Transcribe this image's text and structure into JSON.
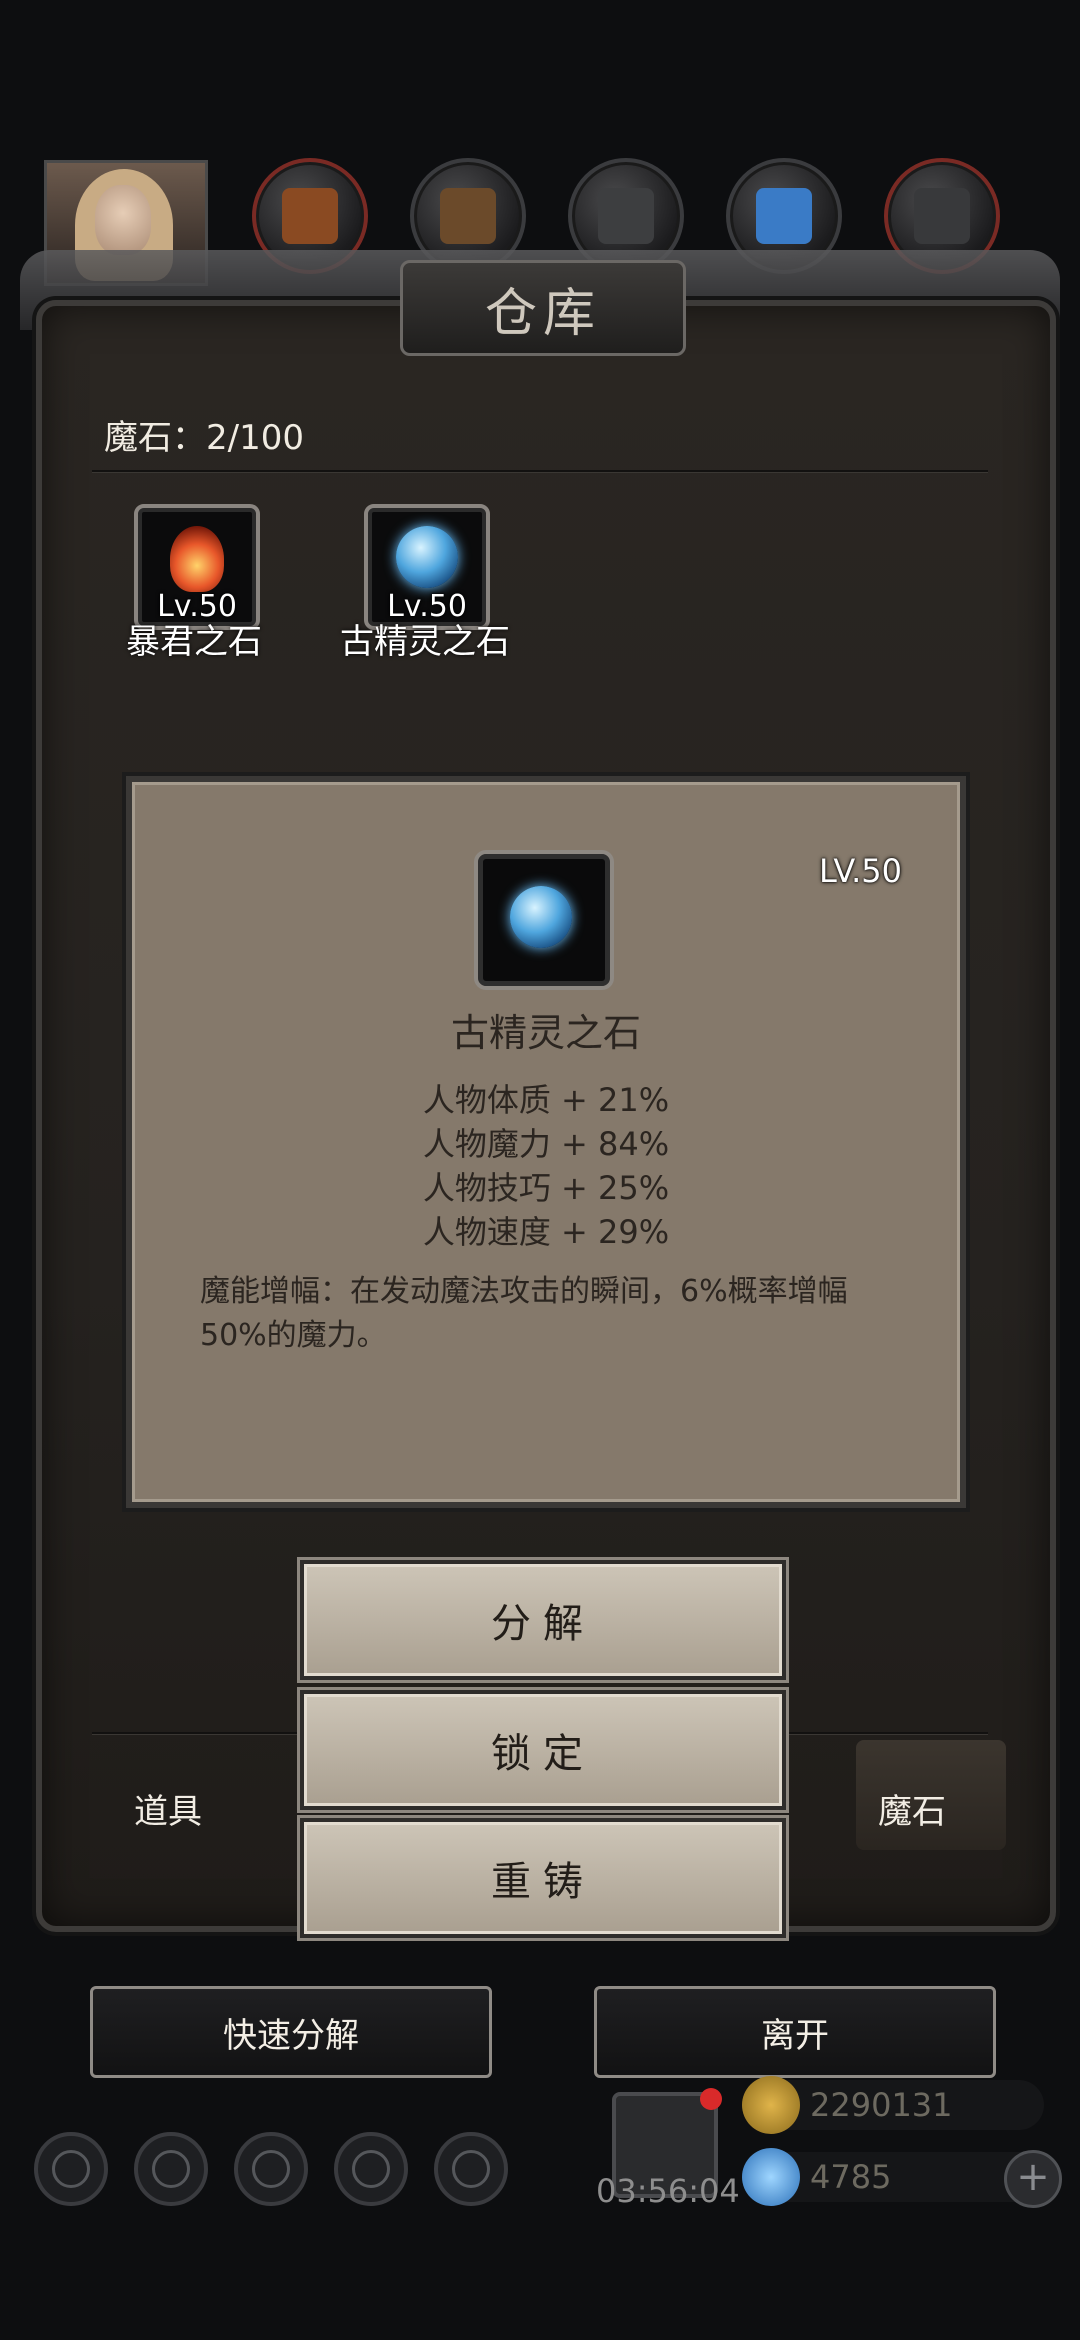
{
  "panel": {
    "title": "仓库",
    "count": "魔石：2/100"
  },
  "items": [
    {
      "level": "Lv.50",
      "name": "暴君之石"
    },
    {
      "level": "Lv.50",
      "name": "古精灵之石"
    }
  ],
  "detail": {
    "level": "LV.50",
    "name": "古精灵之石",
    "stats": [
      "人物体质 + 21%",
      "人物魔力 + 84%",
      "人物技巧 + 25%",
      "人物速度 + 29%"
    ],
    "description": "魔能增幅：在发动魔法攻击的瞬间，6%概率增幅50%的魔力。"
  },
  "actions": {
    "decompose": "分解",
    "lock": "锁定",
    "recast": "重铸"
  },
  "tabs": {
    "items": "道具",
    "magic_stone": "魔石"
  },
  "buttons": {
    "quick_decompose": "快速分解",
    "leave": "离开"
  },
  "footer": {
    "timer": "03:56:04",
    "gold": "2290131",
    "gems": "4785"
  },
  "icons": [
    "portrait",
    "hat-icon",
    "boots-icon",
    "armor-icon",
    "crystal-icon",
    "gauntlet-icon"
  ]
}
